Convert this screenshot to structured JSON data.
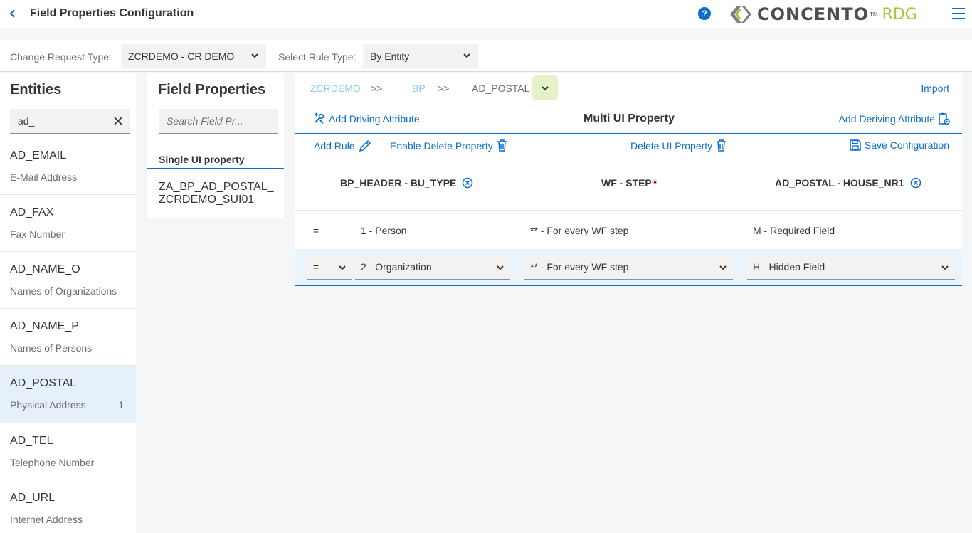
{
  "header": {
    "title": "Field Properties Configuration",
    "help_icon": "?",
    "logo_text": "CONCENTO",
    "logo_tm": "TM",
    "logo_suffix": "RDG"
  },
  "filters": {
    "change_request_label": "Change Request Type:",
    "change_request_value": "ZCRDEMO - CR DEMO",
    "rule_type_label": "Select Rule Type:",
    "rule_type_value": "By Entity"
  },
  "entities": {
    "title": "Entities",
    "search_value": "ad_",
    "items": [
      {
        "code": "AD_EMAIL",
        "desc": "E-Mail Address",
        "count": ""
      },
      {
        "code": "AD_FAX",
        "desc": "Fax Number",
        "count": ""
      },
      {
        "code": "AD_NAME_O",
        "desc": "Names of Organizations",
        "count": ""
      },
      {
        "code": "AD_NAME_P",
        "desc": "Names of Persons",
        "count": ""
      },
      {
        "code": "AD_POSTAL",
        "desc": "Physical Address",
        "count": "1"
      },
      {
        "code": "AD_TEL",
        "desc": "Telephone Number",
        "count": ""
      },
      {
        "code": "AD_URL",
        "desc": "Internet Address",
        "count": ""
      }
    ]
  },
  "field_properties": {
    "title": "Field Properties",
    "search_placeholder": "Search Field Pr...",
    "group_label": "Single UI property",
    "item_line1": "ZA_BP_AD_POSTAL_",
    "item_line2": "ZCRDEMO_SUI01"
  },
  "breadcrumb": {
    "items": [
      "ZCRDEMO",
      "BP",
      "AD_POSTAL"
    ],
    "separator": ">>",
    "import_label": "Import"
  },
  "toolbar": {
    "add_driving": "Add Driving Attribute",
    "center_title": "Multi UI Property",
    "add_deriving": "Add Deriving Attribute",
    "add_rule": "Add Rule",
    "enable_delete": "Enable Delete Property",
    "delete_ui": "Delete UI Property",
    "save_config": "Save Configuration"
  },
  "columns": {
    "col1": "BP_HEADER - BU_TYPE",
    "col2": "WF - STEP",
    "col2_required": "*",
    "col3": "AD_POSTAL - HOUSE_NR1"
  },
  "rules": [
    {
      "op": "=",
      "bu_type": "1 - Person",
      "wf_step": "** - For every WF step",
      "property": "M - Required Field"
    },
    {
      "op": "=",
      "bu_type": "2 - Organization",
      "wf_step": "** - For every WF step",
      "property": "H - Hidden Field"
    }
  ],
  "colors": {
    "accent": "#0a6ed1",
    "brand_green": "#a4c639",
    "selected_bg": "#e5f0fa",
    "required": "#bb0000"
  }
}
